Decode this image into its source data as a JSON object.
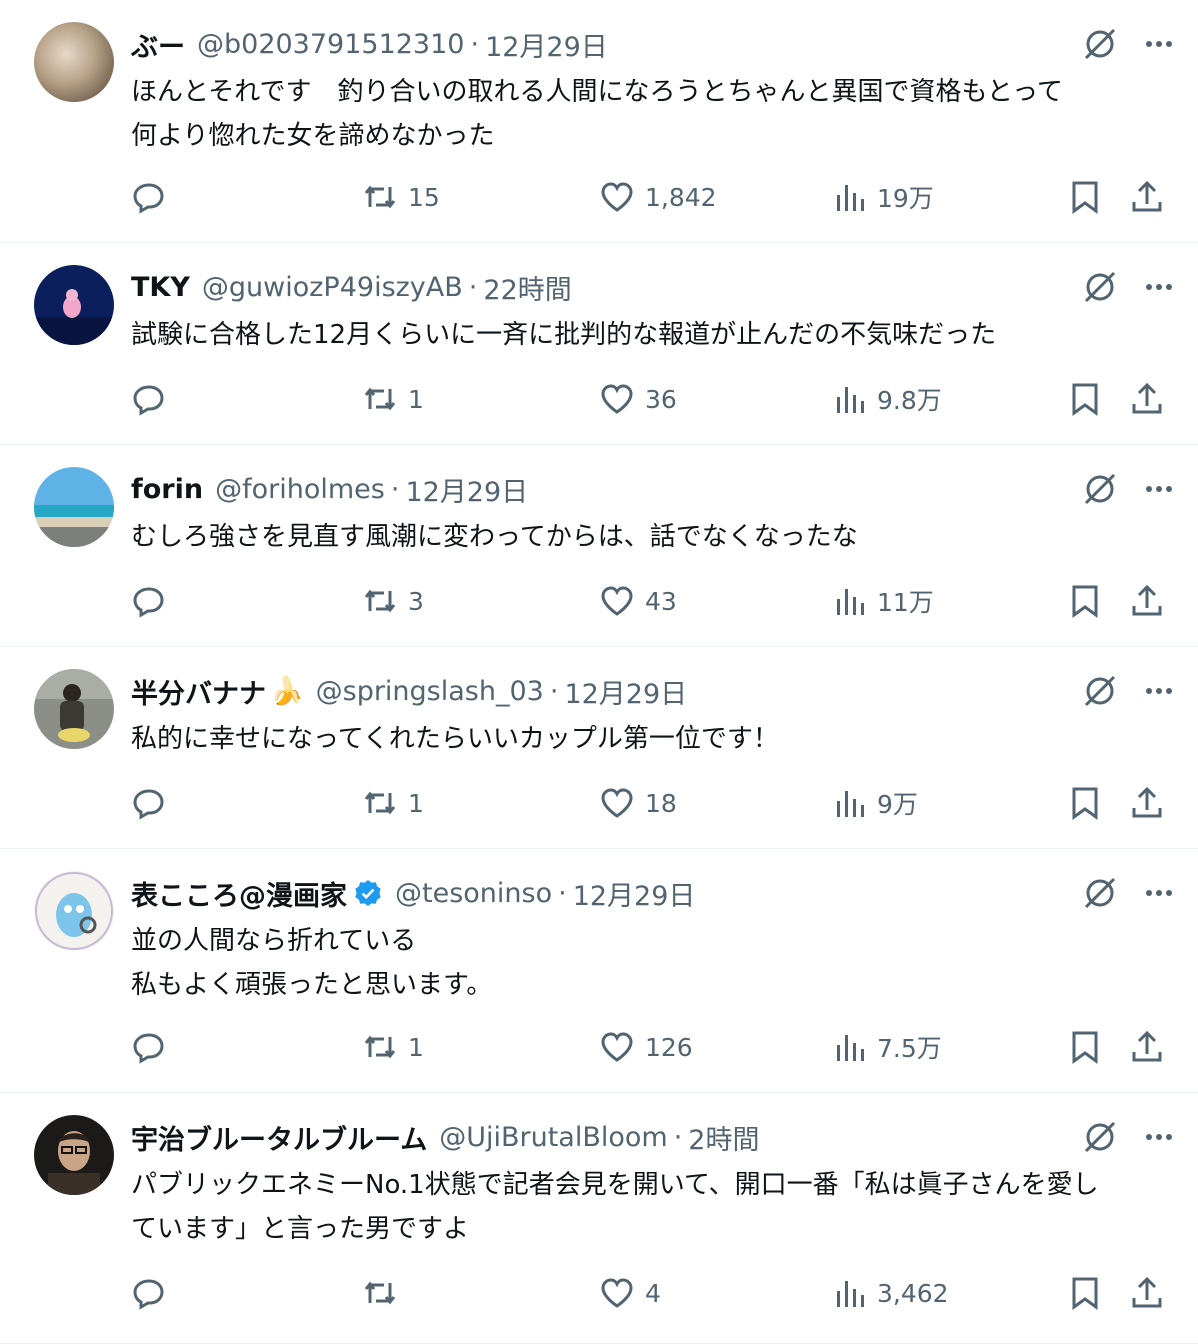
{
  "tweets": [
    {
      "name": "ぶー",
      "emoji": "",
      "verified": false,
      "handle": "@b0203791512310",
      "dot": "·",
      "time": "12月29日",
      "lines": [
        "ほんとそれです　釣り合いの取れる人間になろうとちゃんと異国で資格もとって",
        "何より惚れた女を諦めなかった"
      ],
      "retweets": "15",
      "likes": "1,842",
      "views": "19万",
      "avatar": "blur-brown"
    },
    {
      "name": "TKY",
      "emoji": "",
      "verified": false,
      "handle": "@guwiozP49iszyAB",
      "dot": "·",
      "time": "22時間",
      "lines": [
        "試験に合格した12月くらいに一斉に批判的な報道が止んだの不気味だった"
      ],
      "retweets": "1",
      "likes": "36",
      "views": "9.8万",
      "avatar": "dark-blue-pink"
    },
    {
      "name": "forin",
      "emoji": "",
      "verified": false,
      "handle": "@foriholmes",
      "dot": "·",
      "time": "12月29日",
      "lines": [
        "むしろ強さを見直す風潮に変わってからは、話でなくなったな"
      ],
      "retweets": "3",
      "likes": "43",
      "views": "11万",
      "avatar": "beach"
    },
    {
      "name": "半分バナナ",
      "emoji": "🍌",
      "verified": false,
      "handle": "@springslash_03",
      "dot": "·",
      "time": "12月29日",
      "lines": [
        "私的に幸せになってくれたらいいカップル第一位です！"
      ],
      "retweets": "1",
      "likes": "18",
      "views": "9万",
      "avatar": "figure-street"
    },
    {
      "name": "表こころ@漫画家",
      "emoji": "",
      "verified": true,
      "handle": "@tesoninso",
      "dot": "·",
      "time": "12月29日",
      "lines": [
        "並の人間なら折れている",
        "私もよく頑張ったと思います。"
      ],
      "retweets": "1",
      "likes": "126",
      "views": "7.5万",
      "avatar": "cartoon-blue"
    },
    {
      "name": "宇治ブルータルブルーム",
      "emoji": "",
      "verified": false,
      "handle": "@UjiBrutalBloom",
      "dot": "·",
      "time": "2時間",
      "lines": [
        "パブリックエネミーNo.1状態で記者会見を開いて、開口一番「私は眞子さんを愛し",
        "ています」と言った男ですよ"
      ],
      "retweets": "",
      "likes": "4",
      "views": "3,462",
      "avatar": "man-glasses"
    }
  ],
  "colors": {
    "text": "#0f1419",
    "muted": "#536471",
    "divider": "#eff3f4",
    "verified": "#1d9bf0"
  },
  "icons": [
    "grok-icon",
    "more-icon",
    "reply-icon",
    "retweet-icon",
    "like-icon",
    "views-icon",
    "bookmark-icon",
    "share-icon",
    "verified-icon"
  ]
}
